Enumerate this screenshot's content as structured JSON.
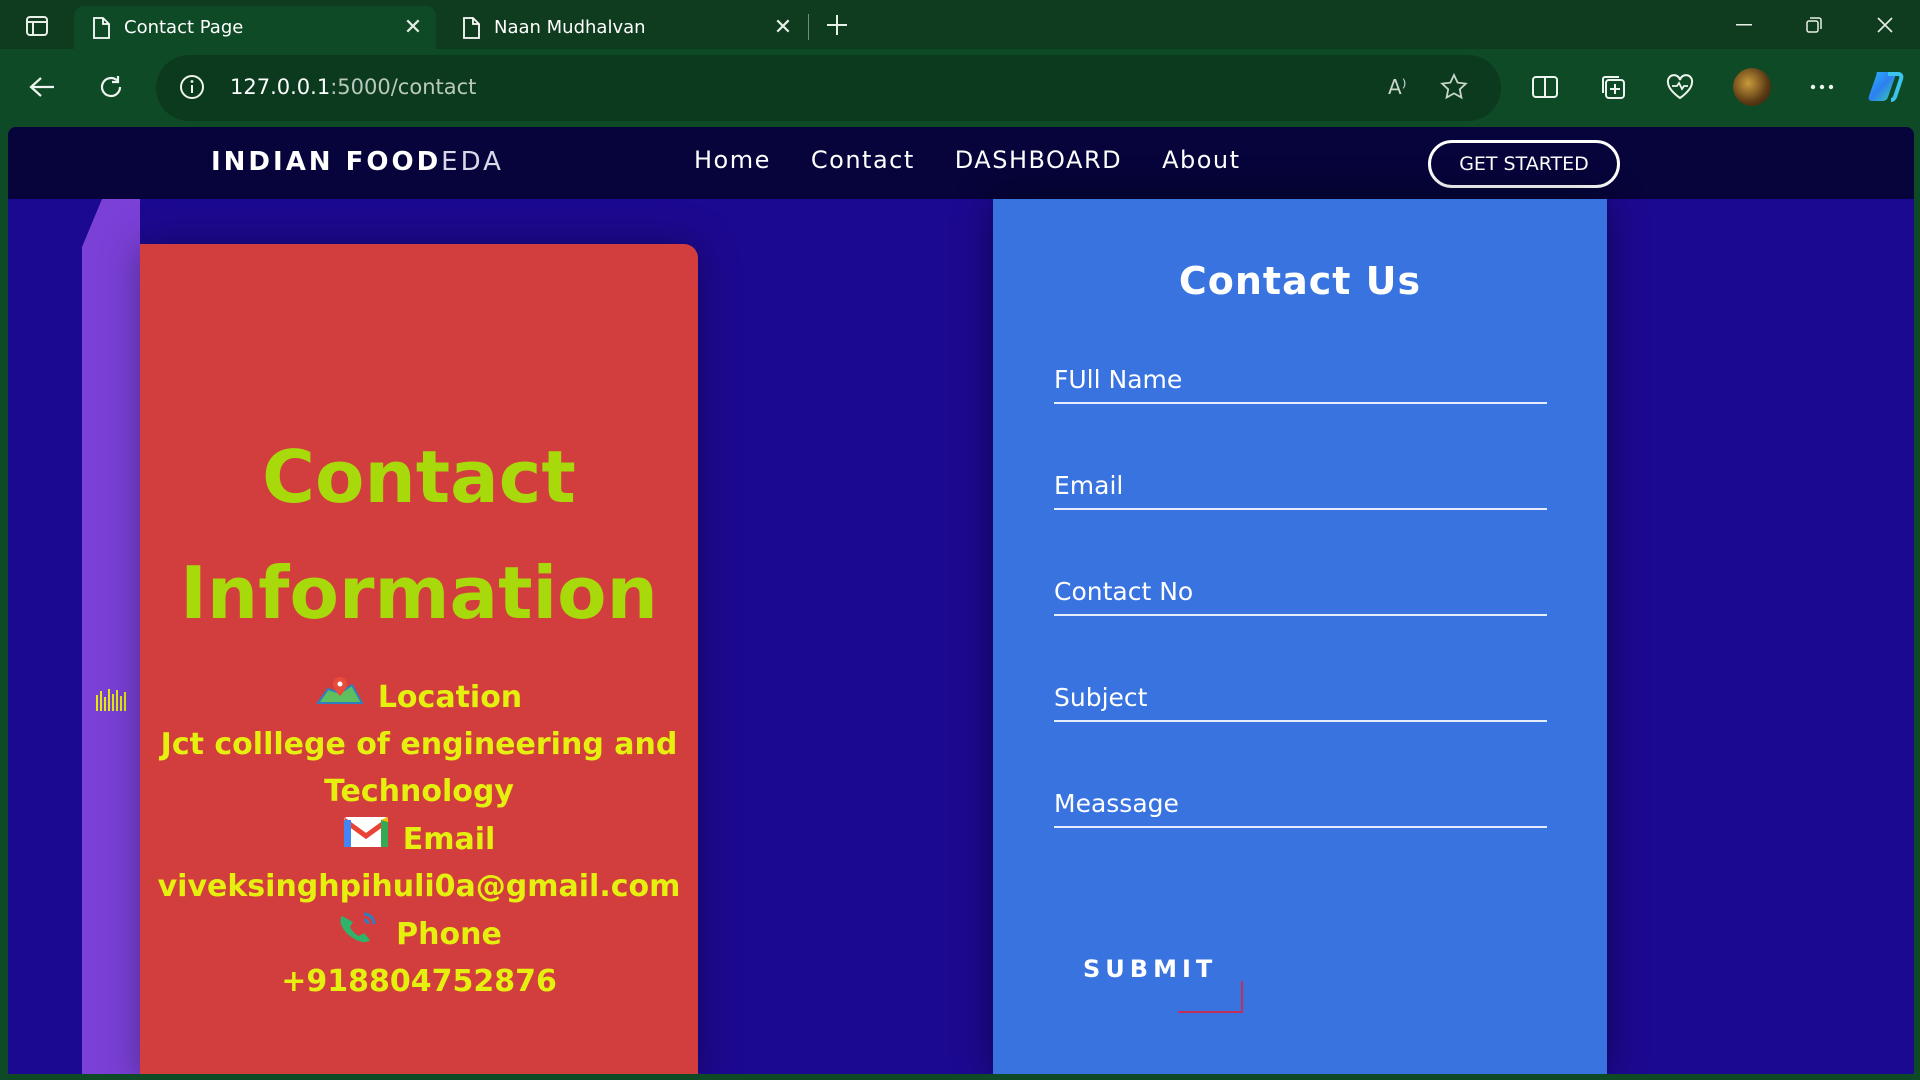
{
  "browser": {
    "tabs": [
      {
        "title": "Contact Page",
        "active": true
      },
      {
        "title": "Naan Mudhalvan",
        "active": false
      }
    ],
    "url": {
      "host": "127.0.0.1",
      "path": ":5000/contact"
    },
    "read_aloud": "A⁾"
  },
  "nav": {
    "brand_bold": "INDIAN FOOD",
    "brand_light": "EDA",
    "links": [
      "Home",
      "Contact",
      "DASHBOARD",
      "About"
    ],
    "cta": "GET STARTED"
  },
  "info": {
    "title_line1": "Contact",
    "title_line2": "Information",
    "location_label": "Location",
    "location_value": "Jct colllege of engineering and Technology",
    "email_label": "Email",
    "email_value": "viveksinghpihuli0a@gmail.com",
    "phone_label": "Phone",
    "phone_value": "+918804752876"
  },
  "form": {
    "title": "Contact Us",
    "placeholders": {
      "name": "FUll Name",
      "email": "Email",
      "contact": "Contact No",
      "subject": "Subject",
      "message": "Meassage"
    },
    "submit": "SUBMIT"
  },
  "colors": {
    "page_bg": "#1c0991",
    "navbar_bg": "#06043a",
    "info_card": "#d23d3d",
    "info_title": "#a8d90a",
    "info_text": "#e6f00f",
    "form_card": "#3873e0",
    "sidebar": "#7b40d8",
    "browser_frame": "#0f4a26"
  }
}
